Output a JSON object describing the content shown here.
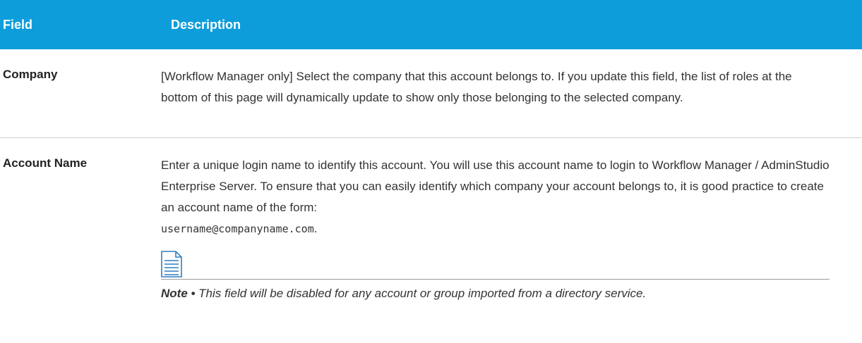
{
  "header": {
    "field": "Field",
    "description": "Description"
  },
  "rows": [
    {
      "field": "Company",
      "description": "[Workflow Manager only] Select the company that this account belongs to. If you update this field, the list of roles at the bottom of this page will dynamically update to show only those belonging to the selected company."
    },
    {
      "field": "Account Name",
      "description": "Enter a unique login name to identify this account. You will use this account name to login to Workflow Manager / AdminStudio Enterprise Server. To ensure that you can easily identify which company your account belongs to, it is good practice to create an account name of the form:",
      "example": "username@companyname.com",
      "example_suffix": ".",
      "note_icon": "note-document-icon",
      "note_label": "Note •",
      "note_text": " This field will be disabled for any account or group imported from a directory service."
    }
  ]
}
